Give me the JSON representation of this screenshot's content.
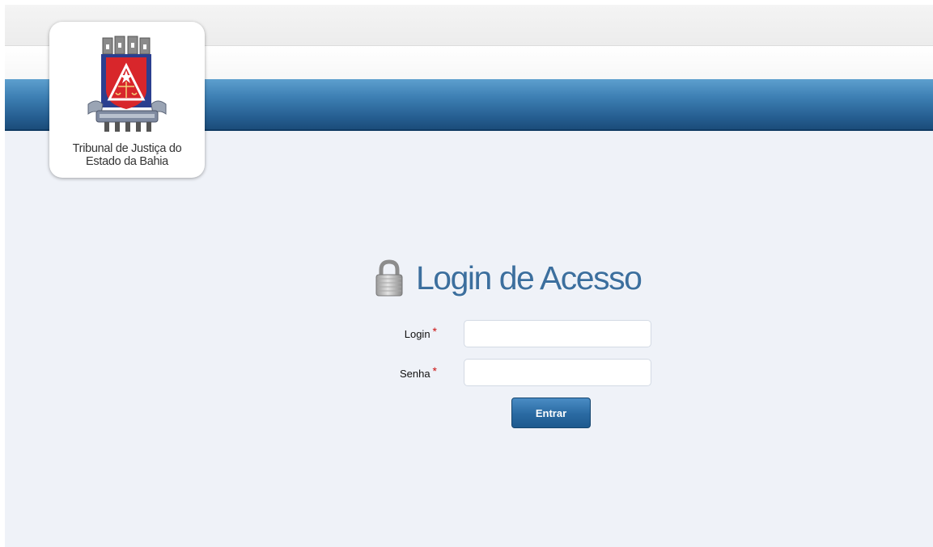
{
  "header": {
    "logo_line1": "Tribunal de Justiça do",
    "logo_line2": "Estado da Bahia",
    "emblem_icon": "coat-of-arms-icon"
  },
  "login": {
    "title": "Login de Acesso",
    "lock_icon": "padlock-icon",
    "login_label": "Login",
    "senha_label": "Senha",
    "required_mark": "*",
    "login_value": "",
    "senha_value": "",
    "submit_label": "Entrar"
  },
  "colors": {
    "header_blue": "#265f92",
    "title_blue": "#3c6f9e",
    "page_bg": "#eff2f8",
    "required_red": "#cc1111"
  }
}
